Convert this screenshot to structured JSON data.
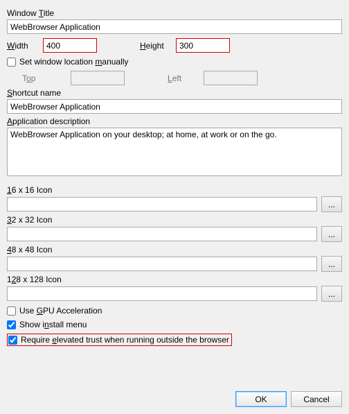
{
  "labels": {
    "window_title": "Window Title",
    "width": "Width",
    "height": "Height",
    "set_manual": "Set window location manually",
    "top": "Top",
    "left": "Left",
    "shortcut_name": "Shortcut name",
    "app_desc": "Application description",
    "icon16": "16 x 16 Icon",
    "icon32": "32 x 32 Icon",
    "icon48": "48 x 48 Icon",
    "icon128": "128 x 128 Icon",
    "use_gpu": "Use GPU Acceleration",
    "show_install": "Show install menu",
    "require_trust": "Require elevated trust when running outside the browser"
  },
  "values": {
    "window_title": "WebBrowser Application",
    "width": "400",
    "height": "300",
    "top": "",
    "left": "",
    "shortcut_name": "WebBrowser Application",
    "app_desc": "WebBrowser Application on your desktop; at home, at work or on the go.",
    "icon16": "",
    "icon32": "",
    "icon48": "",
    "icon128": ""
  },
  "checks": {
    "set_manual": false,
    "use_gpu": false,
    "show_install": true,
    "require_trust": true
  },
  "buttons": {
    "browse": "...",
    "ok": "OK",
    "cancel": "Cancel"
  }
}
